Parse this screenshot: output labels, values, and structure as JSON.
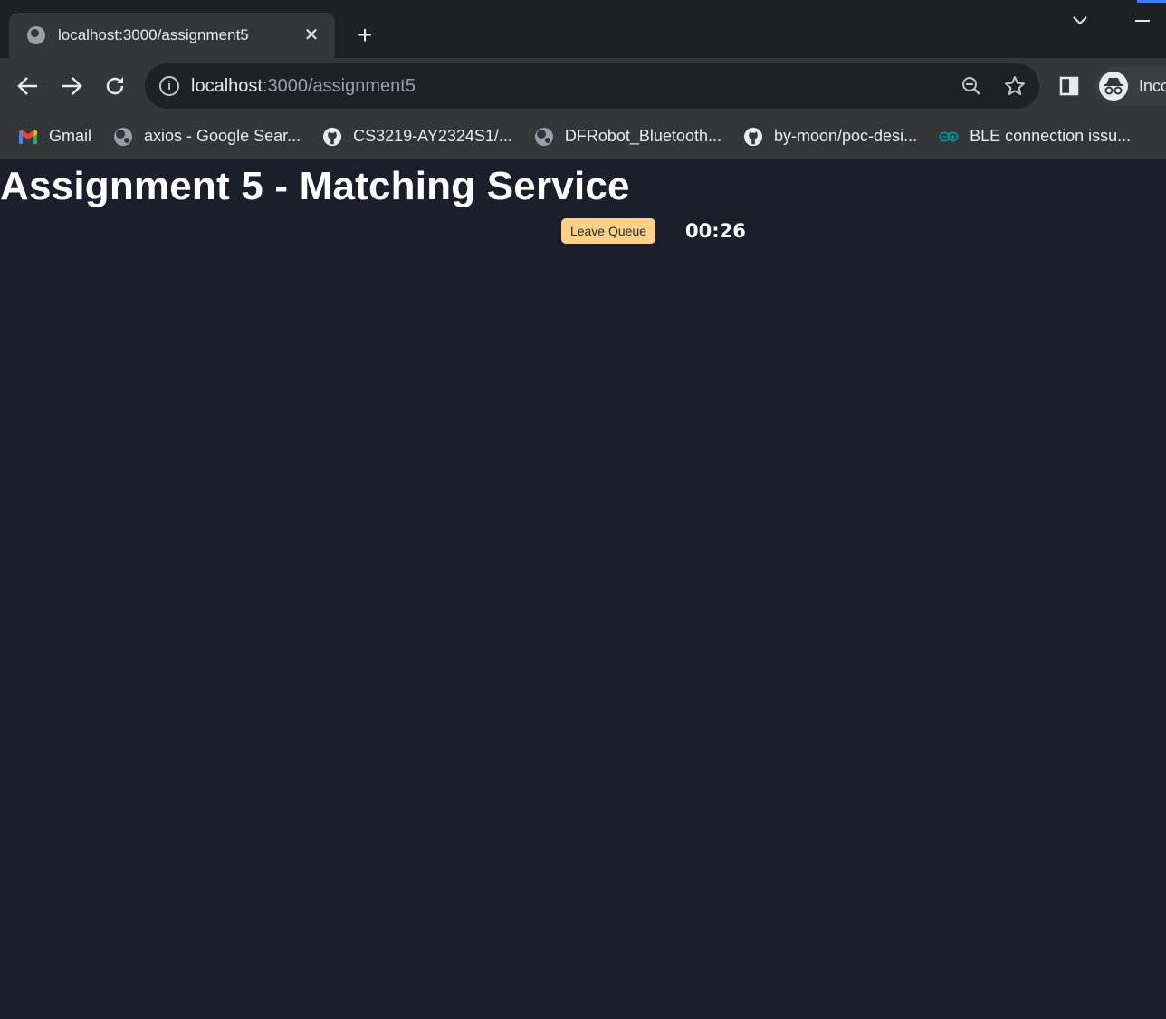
{
  "browser": {
    "tab": {
      "title": "localhost:3000/assignment5",
      "close": "✕"
    },
    "new_tab": "+",
    "address": {
      "host": "localhost",
      "path": ":3000/assignment5"
    },
    "profile_label": "Inco",
    "bookmarks": [
      {
        "label": "Gmail",
        "icon": "gmail-icon"
      },
      {
        "label": "axios - Google Sear...",
        "icon": "globe-icon"
      },
      {
        "label": "CS3219-AY2324S1/...",
        "icon": "github-icon"
      },
      {
        "label": "DFRobot_Bluetooth...",
        "icon": "globe-icon"
      },
      {
        "label": "by-moon/poc-desi...",
        "icon": "github-icon"
      },
      {
        "label": "BLE connection issu...",
        "icon": "arduino-icon"
      }
    ]
  },
  "page": {
    "title": "Assignment 5 - Matching Service",
    "leave_queue_label": "Leave Queue",
    "timer": "00:26"
  },
  "colors": {
    "page_background": "#1b1f2b",
    "button_background": "#fcd089",
    "toolbar": "#35363a"
  }
}
